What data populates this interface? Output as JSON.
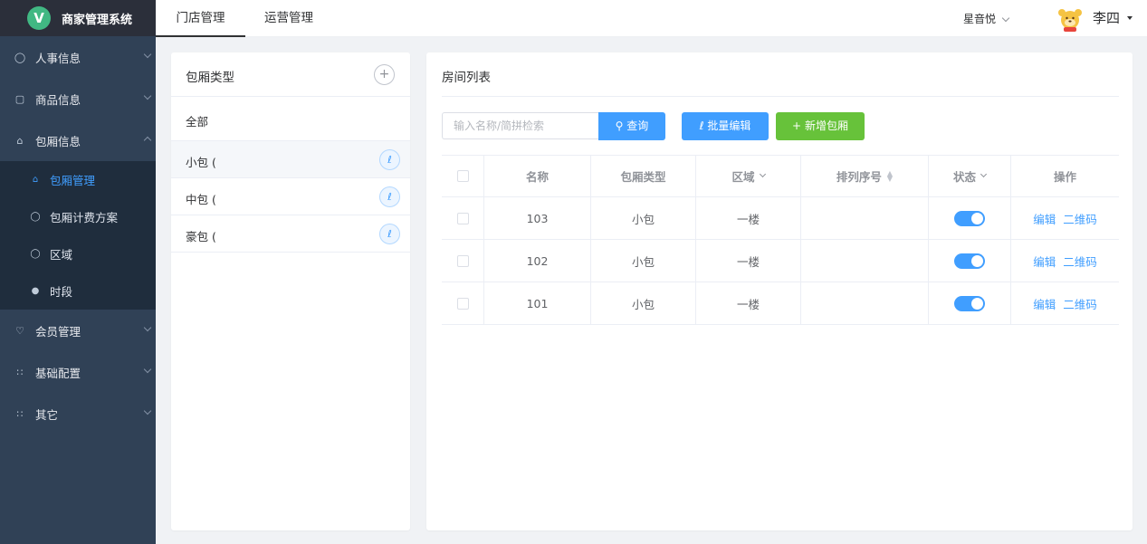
{
  "app": {
    "logo_letter": "V",
    "title": "商家管理系统"
  },
  "sidebar": {
    "menus": [
      {
        "label": "人事信息",
        "icon": "user-icon",
        "expanded": false
      },
      {
        "label": "商品信息",
        "icon": "goods-icon",
        "expanded": false
      },
      {
        "label": "包厢信息",
        "icon": "home-icon",
        "expanded": true,
        "children": [
          {
            "label": "包厢管理",
            "icon": "home-icon",
            "active": true
          },
          {
            "label": "包厢计费方案",
            "icon": "shield-icon",
            "active": false
          },
          {
            "label": "区域",
            "icon": "user-icon",
            "active": false
          },
          {
            "label": "时段",
            "icon": "time-icon",
            "active": false
          }
        ]
      },
      {
        "label": "会员管理",
        "icon": "crown-icon",
        "expanded": false
      },
      {
        "label": "基础配置",
        "icon": "grid-icon",
        "expanded": false
      },
      {
        "label": "其它",
        "icon": "grid-icon",
        "expanded": false
      }
    ]
  },
  "header": {
    "tabs": [
      {
        "label": "门店管理",
        "active": true
      },
      {
        "label": "运营管理",
        "active": false
      }
    ],
    "store": "星音悦",
    "user": "李四"
  },
  "categories": {
    "title": "包厢类型",
    "add_symbol": "+",
    "all_label": "全部",
    "items": [
      {
        "label": "小包 (",
        "highlighted": true
      },
      {
        "label": "中包 (",
        "highlighted": false
      },
      {
        "label": "豪包 (",
        "highlighted": false
      }
    ]
  },
  "rooms": {
    "title": "房间列表",
    "search_placeholder": "输入名称/简拼检索",
    "query_label": "查询",
    "batch_label": "批量编辑",
    "new_label": "新增包厢",
    "columns": {
      "name": "名称",
      "type": "包厢类型",
      "area": "区域",
      "order": "排列序号",
      "status": "状态",
      "actions": "操作"
    },
    "rows": [
      {
        "name": "103",
        "type": "小包",
        "area": "一楼",
        "order": "",
        "status": true,
        "edit": "编辑",
        "qrcode": "二维码"
      },
      {
        "name": "102",
        "type": "小包",
        "area": "一楼",
        "order": "",
        "status": true,
        "edit": "编辑",
        "qrcode": "二维码"
      },
      {
        "name": "101",
        "type": "小包",
        "area": "一楼",
        "order": "",
        "status": true,
        "edit": "编辑",
        "qrcode": "二维码"
      }
    ]
  },
  "colors": {
    "sidebar_bg": "#304156",
    "primary": "#409eff",
    "success": "#67c23a"
  }
}
